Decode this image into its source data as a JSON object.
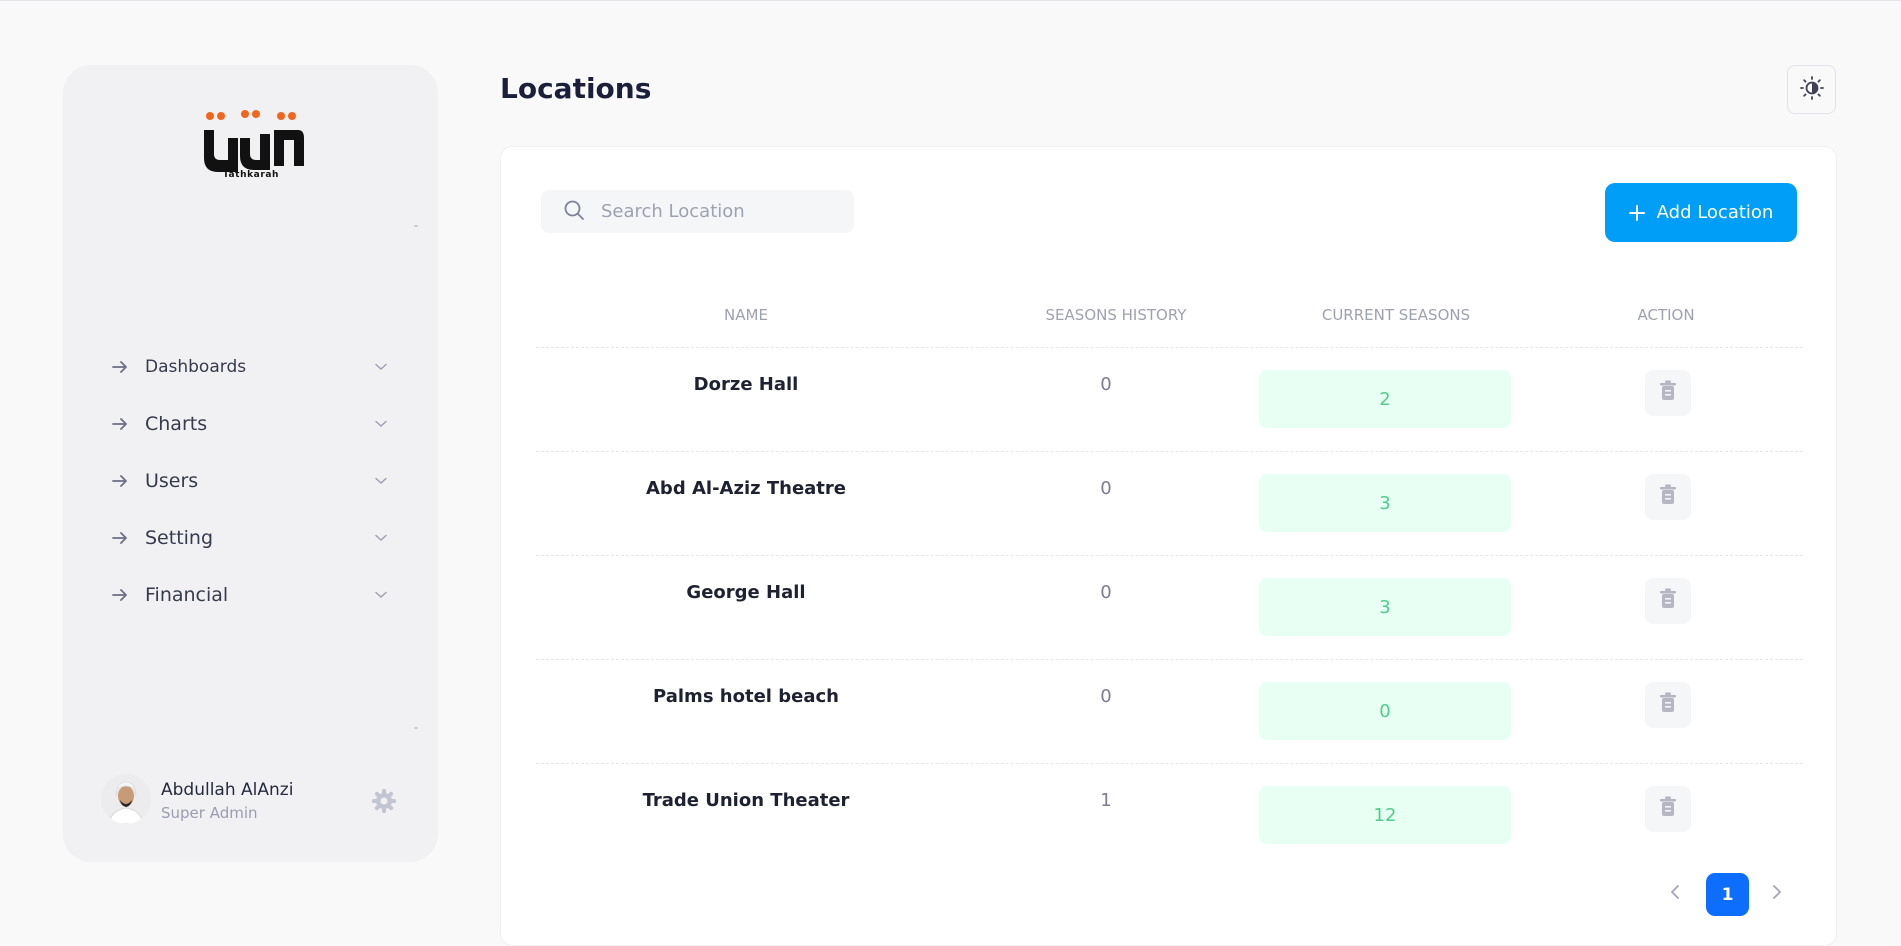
{
  "page": {
    "title": "Locations"
  },
  "brand": {
    "logo_text": "تذكرة",
    "logo_caption": "Tathkarah"
  },
  "sidebar": {
    "items": [
      {
        "label": "Dashboards",
        "icon": "arrow-right-icon"
      },
      {
        "label": "Charts",
        "icon": "arrow-right-icon"
      },
      {
        "label": "Users",
        "icon": "arrow-right-icon"
      },
      {
        "label": "Setting",
        "icon": "arrow-right-icon"
      },
      {
        "label": "Financial",
        "icon": "arrow-right-icon"
      }
    ]
  },
  "user": {
    "name": "Abdullah AlAnzi",
    "role": "Super Admin"
  },
  "toolbar": {
    "search_placeholder": "Search Location",
    "add_label": "Add Location"
  },
  "table": {
    "columns": [
      "NAME",
      "SEASONS HISTORY",
      "CURRENT SEASONS",
      "ACTION"
    ],
    "rows": [
      {
        "name": "Dorze Hall",
        "seasons_history": "0",
        "current_seasons": "2"
      },
      {
        "name": "Abd Al-Aziz Theatre",
        "seasons_history": "0",
        "current_seasons": "3"
      },
      {
        "name": "George Hall",
        "seasons_history": "0",
        "current_seasons": "3"
      },
      {
        "name": "Palms hotel beach",
        "seasons_history": "0",
        "current_seasons": "0"
      },
      {
        "name": "Trade Union Theater",
        "seasons_history": "1",
        "current_seasons": "12"
      }
    ]
  },
  "pagination": {
    "current_page": "1"
  },
  "colors": {
    "accent": "#009ef7",
    "pager_active": "#0d6efd",
    "success_text": "#50cd89",
    "success_bg": "#e8fff3",
    "logo_dots": "#f1661f"
  }
}
